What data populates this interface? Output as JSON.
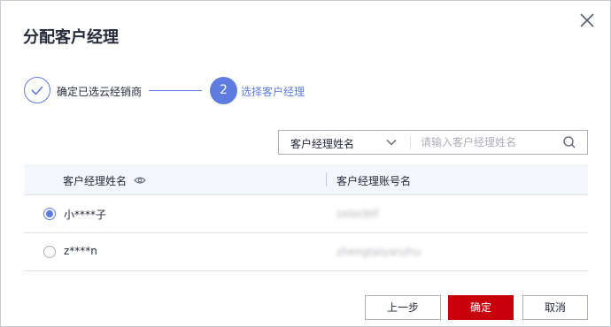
{
  "dialog": {
    "title": "分配客户经理",
    "close_icon": "close-icon"
  },
  "steps": [
    {
      "label": "确定已选云经销商",
      "status": "done",
      "icon": "check-icon"
    },
    {
      "number": "2",
      "label": "选择客户经理",
      "status": "active"
    }
  ],
  "search": {
    "field_value": "客户经理姓名",
    "placeholder": "请输入客户经理姓名",
    "value": ""
  },
  "table": {
    "columns": [
      {
        "label": "客户经理姓名",
        "icon": "eye-icon"
      },
      {
        "label": "客户经理账号名"
      }
    ],
    "rows": [
      {
        "name": "小****子",
        "account": "zxlocbtf",
        "selected": true
      },
      {
        "name": "z****n",
        "account": "zhengtaiyanzhu",
        "selected": false
      }
    ]
  },
  "footer": {
    "prev_label": "上一步",
    "ok_label": "确定",
    "cancel_label": "取消"
  },
  "colors": {
    "accent": "#5e7ce0",
    "primary_button": "#c7000b",
    "text": "#252b3a",
    "header_bg": "#f3f6fa"
  }
}
